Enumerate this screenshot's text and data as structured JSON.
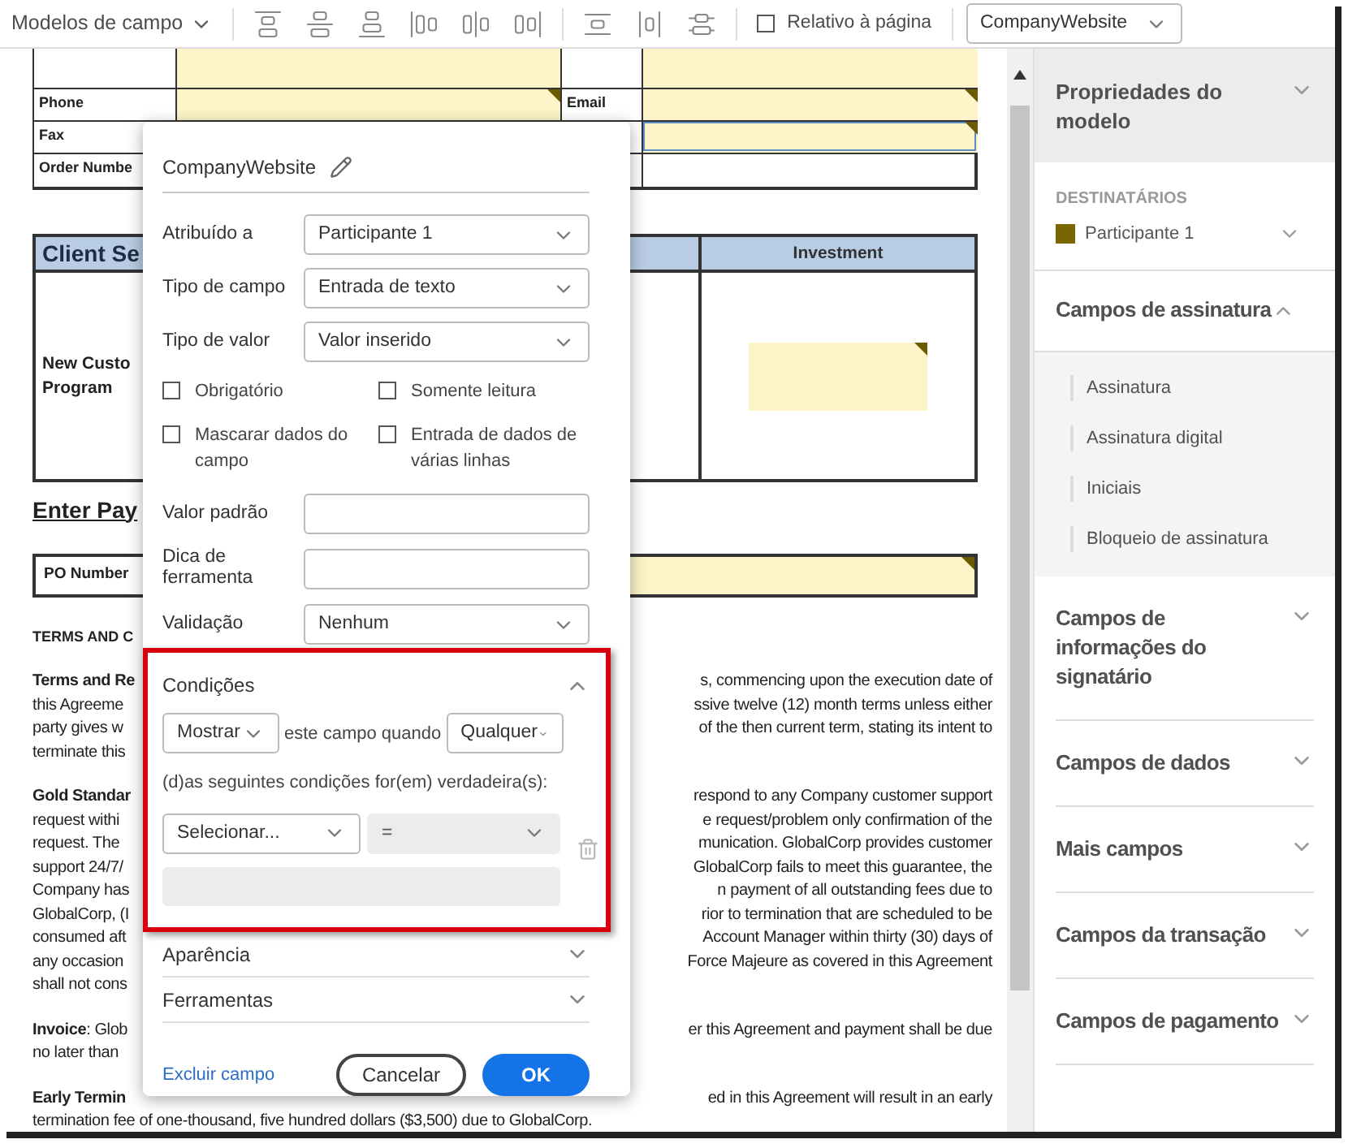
{
  "toolbar": {
    "templates_menu": "Modelos de campo",
    "relative_to_page": {
      "label": "Relativo à página",
      "checked": false
    },
    "field_select": {
      "value": "CompanyWebsite"
    }
  },
  "document": {
    "top_table": {
      "rows": [
        {
          "cells": [
            {
              "kind": "empty"
            },
            {
              "kind": "field",
              "flagged": false,
              "selected": false
            },
            {
              "kind": "empty"
            },
            {
              "kind": "field",
              "flagged": false,
              "selected": false
            }
          ]
        },
        {
          "cells": [
            {
              "kind": "label",
              "text": "Phone"
            },
            {
              "kind": "field",
              "flagged": true,
              "selected": false
            },
            {
              "kind": "label",
              "text": "Email"
            },
            {
              "kind": "field",
              "flagged": true,
              "selected": false
            }
          ]
        },
        {
          "cells": [
            {
              "kind": "label",
              "text": "Fax"
            },
            {
              "kind": "empty"
            },
            {
              "kind": "empty"
            },
            {
              "kind": "field",
              "flagged": true,
              "selected": true
            }
          ]
        },
        {
          "cells": [
            {
              "kind": "label",
              "text": "Order Numbe"
            },
            {
              "kind": "empty"
            },
            {
              "kind": "empty"
            },
            {
              "kind": "empty"
            }
          ]
        }
      ]
    },
    "client_table": {
      "header_left": "Client Se",
      "header_right": "Investment",
      "row_label_lines": [
        "New Custo",
        "Program"
      ],
      "investment_field": {
        "flagged": true
      }
    },
    "payment_heading": "Enter Pay",
    "po_row": {
      "label": "PO Number",
      "field": {
        "flagged": true
      }
    },
    "terms_heading": "TERMS AND C",
    "paragraphs": [
      {
        "lines": [
          {
            "left": "**Terms and Re**",
            "right": "s, commencing upon the execution date of"
          },
          {
            "left": "this Agreeme",
            "right": "ssive twelve (12) month terms unless either"
          },
          {
            "left": "party gives w",
            "right": "of the then current term, stating its intent to"
          },
          {
            "left": "terminate this"
          }
        ]
      },
      {
        "lines": [
          {
            "left": "**Gold Standar**",
            "right": "respond to any Company customer support"
          },
          {
            "left": "request withi",
            "right": "e request/problem only confirmation of the"
          },
          {
            "left": "request. The",
            "right": "munication. GlobalCorp provides customer"
          },
          {
            "left": "support 24/7/",
            "right": "GlobalCorp fails to meet this guarantee, the"
          },
          {
            "left": "Company has",
            "right": "n payment of all outstanding fees due to"
          },
          {
            "left": "GlobalCorp, (I",
            "right": "rior to termination that are scheduled to be"
          },
          {
            "left": "consumed aft",
            "right": "Account Manager within thirty (30) days of"
          },
          {
            "left": "any occasion",
            "right": "Force Majeure as covered in this Agreement"
          },
          {
            "left": "shall not cons"
          }
        ]
      },
      {
        "lines": [
          {
            "left": "**Invoice**: Glob",
            "right": "er this Agreement and payment shall be due"
          },
          {
            "left": "no later than"
          }
        ]
      },
      {
        "lines": [
          {
            "left": "**Early Termin**",
            "right": "ed in this Agreement will result in an early"
          },
          {
            "left": "termination fee of one-thousand, five hundred dollars ($3,500) due to GlobalCorp."
          }
        ]
      }
    ]
  },
  "field_dialog": {
    "field_name": "CompanyWebsite",
    "selects": [
      {
        "label": "Atribuído a",
        "value": "Participante 1"
      },
      {
        "label": "Tipo de campo",
        "value": "Entrada de texto"
      },
      {
        "label": "Tipo de valor",
        "value": "Valor inserido"
      }
    ],
    "options": [
      {
        "label": "Obrigatório",
        "checked": false
      },
      {
        "label": "Somente leitura",
        "checked": false
      },
      {
        "label": "Mascarar dados do campo",
        "checked": false
      },
      {
        "label": "Entrada de dados de várias linhas",
        "checked": false
      }
    ],
    "text_inputs": [
      {
        "label": "Valor padrão"
      },
      {
        "label": "Dica de ferramenta"
      }
    ],
    "validation": {
      "label": "Validação",
      "value": "Nenhum"
    },
    "conditions": {
      "title": "Condições",
      "expanded": true,
      "highlighted": true,
      "action": "Mostrar",
      "connector": "este campo quando",
      "match": "Qualquer",
      "sentence": "(d)as seguintes condições for(em) verdadeira(s):",
      "rule": {
        "field": "Selecionar...",
        "operator": "=",
        "operator_disabled": true
      }
    },
    "sections": [
      {
        "title": "Aparência",
        "expanded": false
      },
      {
        "title": "Ferramentas",
        "expanded": false
      }
    ],
    "delete_link": "Excluir campo",
    "cancel_button": "Cancelar",
    "ok_button": "OK"
  },
  "side_panel": {
    "header": {
      "title": "Propriedades do modelo",
      "expanded": false
    },
    "recipients": {
      "label": "DESTINATÁRIOS",
      "participants": [
        {
          "name": "Participante 1",
          "color": "#7a6500"
        }
      ]
    },
    "sections": [
      {
        "title": "Campos de assinatura",
        "expanded": true,
        "items": [
          "Assinatura",
          "Assinatura digital",
          "Iniciais",
          "Bloqueio de assinatura"
        ]
      },
      {
        "title": "Campos de informações do signatário",
        "expanded": false
      },
      {
        "title": "Campos de dados",
        "expanded": false
      },
      {
        "title": "Mais campos",
        "expanded": false
      },
      {
        "title": "Campos da transação",
        "expanded": false
      },
      {
        "title": "Campos de pagamento",
        "expanded": false
      }
    ]
  }
}
